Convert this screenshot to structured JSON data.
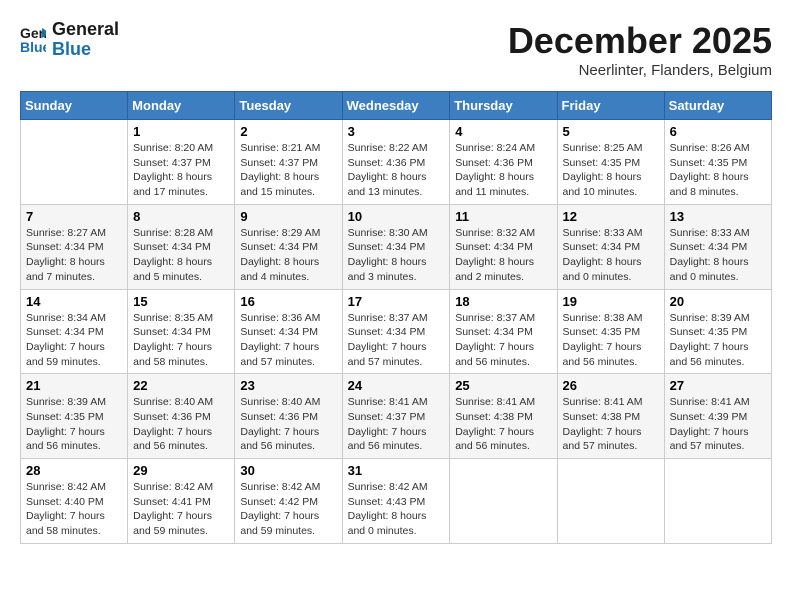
{
  "logo": {
    "general": "General",
    "blue": "Blue"
  },
  "title": "December 2025",
  "location": "Neerlinter, Flanders, Belgium",
  "days_of_week": [
    "Sunday",
    "Monday",
    "Tuesday",
    "Wednesday",
    "Thursday",
    "Friday",
    "Saturday"
  ],
  "weeks": [
    [
      {
        "day": "",
        "info": ""
      },
      {
        "day": "1",
        "info": "Sunrise: 8:20 AM\nSunset: 4:37 PM\nDaylight: 8 hours\nand 17 minutes."
      },
      {
        "day": "2",
        "info": "Sunrise: 8:21 AM\nSunset: 4:37 PM\nDaylight: 8 hours\nand 15 minutes."
      },
      {
        "day": "3",
        "info": "Sunrise: 8:22 AM\nSunset: 4:36 PM\nDaylight: 8 hours\nand 13 minutes."
      },
      {
        "day": "4",
        "info": "Sunrise: 8:24 AM\nSunset: 4:36 PM\nDaylight: 8 hours\nand 11 minutes."
      },
      {
        "day": "5",
        "info": "Sunrise: 8:25 AM\nSunset: 4:35 PM\nDaylight: 8 hours\nand 10 minutes."
      },
      {
        "day": "6",
        "info": "Sunrise: 8:26 AM\nSunset: 4:35 PM\nDaylight: 8 hours\nand 8 minutes."
      }
    ],
    [
      {
        "day": "7",
        "info": "Sunrise: 8:27 AM\nSunset: 4:34 PM\nDaylight: 8 hours\nand 7 minutes."
      },
      {
        "day": "8",
        "info": "Sunrise: 8:28 AM\nSunset: 4:34 PM\nDaylight: 8 hours\nand 5 minutes."
      },
      {
        "day": "9",
        "info": "Sunrise: 8:29 AM\nSunset: 4:34 PM\nDaylight: 8 hours\nand 4 minutes."
      },
      {
        "day": "10",
        "info": "Sunrise: 8:30 AM\nSunset: 4:34 PM\nDaylight: 8 hours\nand 3 minutes."
      },
      {
        "day": "11",
        "info": "Sunrise: 8:32 AM\nSunset: 4:34 PM\nDaylight: 8 hours\nand 2 minutes."
      },
      {
        "day": "12",
        "info": "Sunrise: 8:33 AM\nSunset: 4:34 PM\nDaylight: 8 hours\nand 0 minutes."
      },
      {
        "day": "13",
        "info": "Sunrise: 8:33 AM\nSunset: 4:34 PM\nDaylight: 8 hours\nand 0 minutes."
      }
    ],
    [
      {
        "day": "14",
        "info": "Sunrise: 8:34 AM\nSunset: 4:34 PM\nDaylight: 7 hours\nand 59 minutes."
      },
      {
        "day": "15",
        "info": "Sunrise: 8:35 AM\nSunset: 4:34 PM\nDaylight: 7 hours\nand 58 minutes."
      },
      {
        "day": "16",
        "info": "Sunrise: 8:36 AM\nSunset: 4:34 PM\nDaylight: 7 hours\nand 57 minutes."
      },
      {
        "day": "17",
        "info": "Sunrise: 8:37 AM\nSunset: 4:34 PM\nDaylight: 7 hours\nand 57 minutes."
      },
      {
        "day": "18",
        "info": "Sunrise: 8:37 AM\nSunset: 4:34 PM\nDaylight: 7 hours\nand 56 minutes."
      },
      {
        "day": "19",
        "info": "Sunrise: 8:38 AM\nSunset: 4:35 PM\nDaylight: 7 hours\nand 56 minutes."
      },
      {
        "day": "20",
        "info": "Sunrise: 8:39 AM\nSunset: 4:35 PM\nDaylight: 7 hours\nand 56 minutes."
      }
    ],
    [
      {
        "day": "21",
        "info": "Sunrise: 8:39 AM\nSunset: 4:35 PM\nDaylight: 7 hours\nand 56 minutes."
      },
      {
        "day": "22",
        "info": "Sunrise: 8:40 AM\nSunset: 4:36 PM\nDaylight: 7 hours\nand 56 minutes."
      },
      {
        "day": "23",
        "info": "Sunrise: 8:40 AM\nSunset: 4:36 PM\nDaylight: 7 hours\nand 56 minutes."
      },
      {
        "day": "24",
        "info": "Sunrise: 8:41 AM\nSunset: 4:37 PM\nDaylight: 7 hours\nand 56 minutes."
      },
      {
        "day": "25",
        "info": "Sunrise: 8:41 AM\nSunset: 4:38 PM\nDaylight: 7 hours\nand 56 minutes."
      },
      {
        "day": "26",
        "info": "Sunrise: 8:41 AM\nSunset: 4:38 PM\nDaylight: 7 hours\nand 57 minutes."
      },
      {
        "day": "27",
        "info": "Sunrise: 8:41 AM\nSunset: 4:39 PM\nDaylight: 7 hours\nand 57 minutes."
      }
    ],
    [
      {
        "day": "28",
        "info": "Sunrise: 8:42 AM\nSunset: 4:40 PM\nDaylight: 7 hours\nand 58 minutes."
      },
      {
        "day": "29",
        "info": "Sunrise: 8:42 AM\nSunset: 4:41 PM\nDaylight: 7 hours\nand 59 minutes."
      },
      {
        "day": "30",
        "info": "Sunrise: 8:42 AM\nSunset: 4:42 PM\nDaylight: 7 hours\nand 59 minutes."
      },
      {
        "day": "31",
        "info": "Sunrise: 8:42 AM\nSunset: 4:43 PM\nDaylight: 8 hours\nand 0 minutes."
      },
      {
        "day": "",
        "info": ""
      },
      {
        "day": "",
        "info": ""
      },
      {
        "day": "",
        "info": ""
      }
    ]
  ]
}
